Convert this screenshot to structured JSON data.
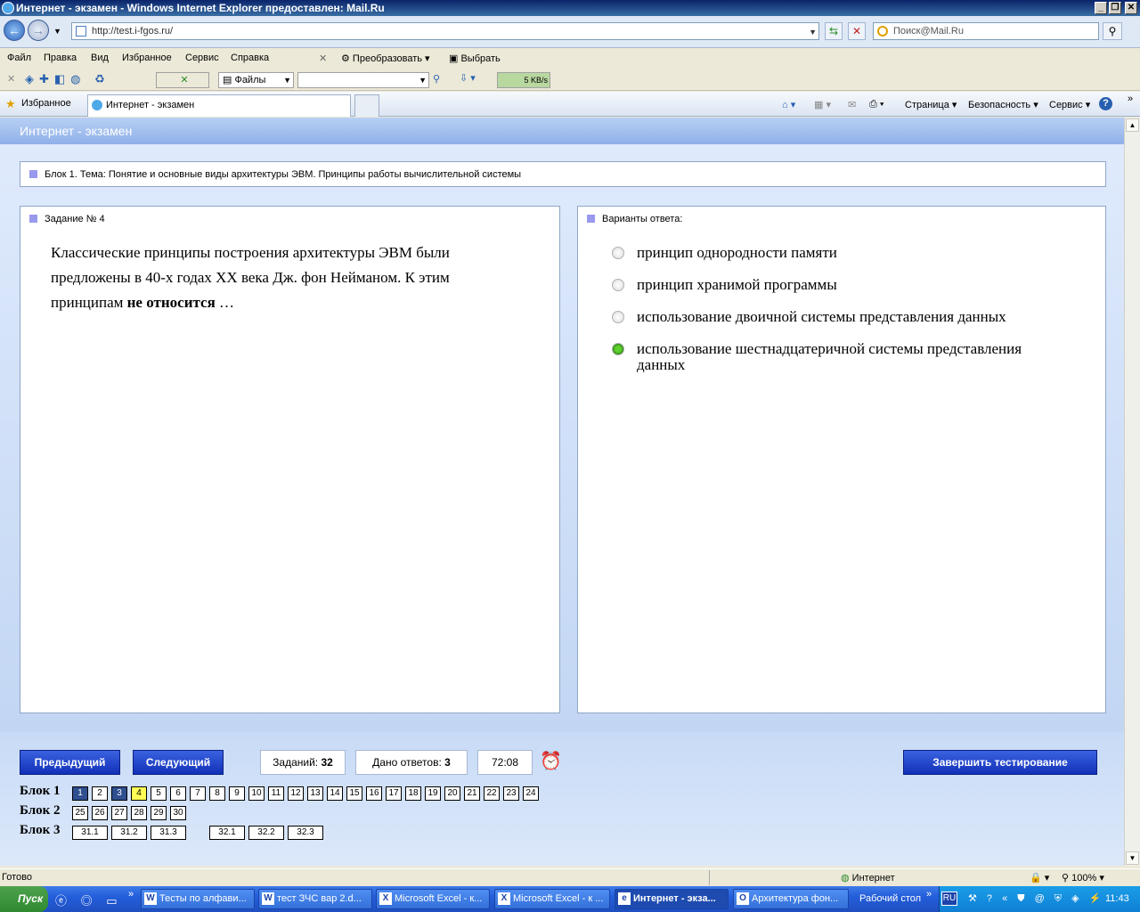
{
  "window": {
    "title": "Интернет - экзамен - Windows Internet Explorer предоставлен: Mail.Ru",
    "controls": [
      "_",
      "❐",
      "✕"
    ]
  },
  "address": {
    "url": "http://test.i-fgos.ru/",
    "search_placeholder": "Поиск@Mail.Ru"
  },
  "menu": [
    "Файл",
    "Правка",
    "Вид",
    "Избранное",
    "Сервис",
    "Справка"
  ],
  "toolbar": {
    "convert_label": "Преобразовать",
    "select_label": "Выбрать",
    "files_label": "Файлы",
    "speed": "5 KB/s"
  },
  "favbar": {
    "favorites_label": "Избранное",
    "tab_title": "Интернет - экзамен",
    "page_label": "Страница",
    "safety_label": "Безопасность",
    "service_label": "Сервис"
  },
  "app": {
    "header": "Интернет - экзамен",
    "block_title": "Блок 1. Тема: Понятие и основные виды архитектуры ЭВМ. Принципы работы вычислительной системы",
    "task_label": "Задание № 4",
    "question_part1": "Классические принципы построения архитектуры ЭВМ были предложены в 40-х годах XX века Дж. фон Нейманом. К этим принципам ",
    "question_bold": "не относится",
    "question_part2": " …",
    "answers_label": "Варианты ответа:",
    "options": [
      {
        "text": "принцип однородности памяти",
        "selected": false
      },
      {
        "text": "принцип хранимой программы",
        "selected": false
      },
      {
        "text": "использование двоичной системы представления данных",
        "selected": false
      },
      {
        "text": "использование шестнадцатеричной системы представления данных",
        "selected": true
      }
    ],
    "prev_button": "Предыдущий",
    "next_button": "Следующий",
    "tasks_label": "Заданий:",
    "tasks_count": "32",
    "answered_label": "Дано ответов:",
    "answered_count": "3",
    "timer": "72:08",
    "finish_button": "Завершить тестирование",
    "block1_label": "Блок 1",
    "block2_label": "Блок 2",
    "block3_label": "Блок 3",
    "block1_cells": [
      "1",
      "2",
      "3",
      "4",
      "5",
      "6",
      "7",
      "8",
      "9",
      "10",
      "11",
      "12",
      "13",
      "14",
      "15",
      "16",
      "17",
      "18",
      "19",
      "20",
      "21",
      "22",
      "23",
      "24"
    ],
    "block1_done": [
      "1",
      "3"
    ],
    "block1_current": "4",
    "block2_cells": [
      "25",
      "26",
      "27",
      "28",
      "29",
      "30"
    ],
    "block3_cells": [
      "31.1",
      "31.2",
      "31.3",
      "32.1",
      "32.2",
      "32.3"
    ]
  },
  "status": {
    "text": "Готово",
    "zone": "Интернет",
    "zoom": "100%"
  },
  "taskbar": {
    "start": "Пуск",
    "tasks": [
      {
        "label": "Тесты по алфави...",
        "icon": "W"
      },
      {
        "label": "тест ЗЧС вар 2.d...",
        "icon": "W"
      },
      {
        "label": "Microsoft Excel - к...",
        "icon": "X"
      },
      {
        "label": "Microsoft Excel - к ...",
        "icon": "X"
      },
      {
        "label": "Интернет - экза...",
        "icon": "e"
      },
      {
        "label": "Архитектура фон...",
        "icon": "O"
      }
    ],
    "desktop_label": "Рабочий стол",
    "lang": "RU",
    "clock": "11:43"
  }
}
